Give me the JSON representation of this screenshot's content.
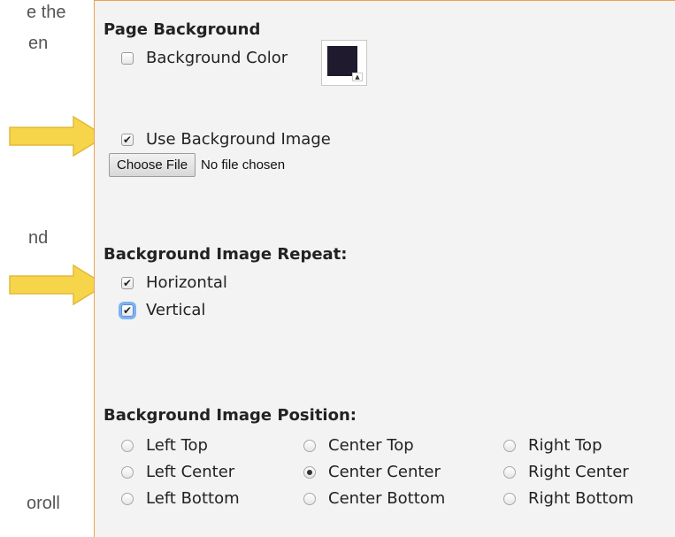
{
  "left_fragments": [
    "e the",
    "en",
    "nd",
    "oroll"
  ],
  "page_background": {
    "heading": "Page Background",
    "background_color_label": "Background Color",
    "background_color_checked": false,
    "swatch_color": "#1f1a2e",
    "use_image_label": "Use Background Image",
    "use_image_checked": true,
    "choose_file_label": "Choose File",
    "file_status": "No file chosen"
  },
  "repeat": {
    "heading": "Background Image Repeat:",
    "horizontal_label": "Horizontal",
    "vertical_label": "Vertical"
  },
  "position": {
    "heading": "Background Image Position:",
    "options": [
      "Left Top",
      "Center Top",
      "Right Top",
      "Left Center",
      "Center Center",
      "Right Center",
      "Left Bottom",
      "Center Bottom",
      "Right Bottom"
    ],
    "selected": "Center Center"
  },
  "colors": {
    "arrow": "#f7d54a",
    "panel_border": "#f0a04b"
  }
}
